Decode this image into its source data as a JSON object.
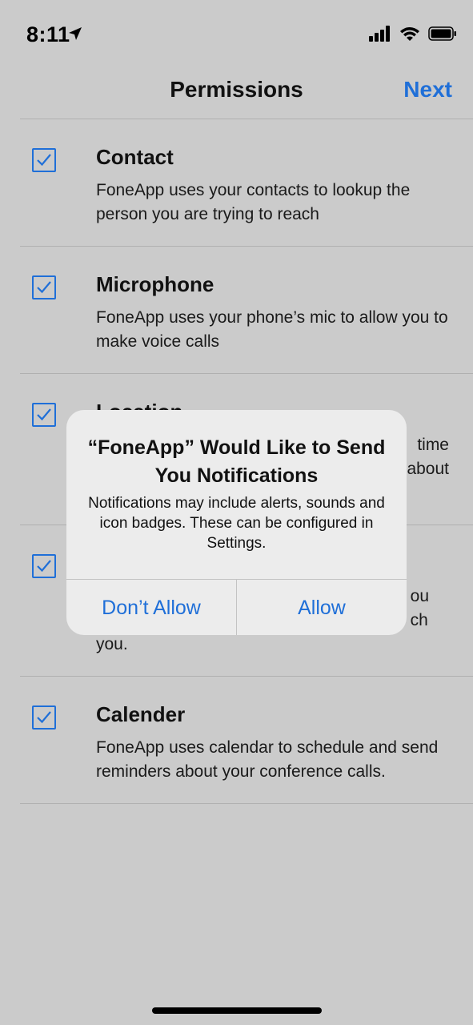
{
  "status_bar": {
    "time": "8:11",
    "icons": [
      "location-arrow-icon",
      "cellular-signal-icon",
      "wifi-icon",
      "battery-icon"
    ]
  },
  "nav": {
    "title": "Permissions",
    "next_label": "Next"
  },
  "permissions": [
    {
      "title": "Contact",
      "description": "FoneApp uses your contacts to lookup the person you are trying to reach",
      "checked": true
    },
    {
      "title": "Microphone",
      "description": "FoneApp uses your phone’s mic to allow you to make voice calls",
      "checked": true
    },
    {
      "title": "Location",
      "description_visible_fragment_1": "time",
      "description_visible_fragment_2": "about",
      "checked": true
    },
    {
      "description_visible_fragment_1": "ou",
      "description_visible_fragment_2": "ch",
      "description_visible_fragment_3": "you.",
      "checked": true
    },
    {
      "title": "Calender",
      "description": "FoneApp uses calendar to schedule and send reminders about your conference calls.",
      "checked": true
    }
  ],
  "alert": {
    "title": "“FoneApp” Would Like to Send You Notifications",
    "message": "Notifications may include alerts, sounds and icon badges. These can be configured in Settings.",
    "deny_label": "Don’t Allow",
    "allow_label": "Allow"
  },
  "colors": {
    "accent": "#1f6fd8",
    "background": "#cbcbcb",
    "alert_background": "#ececec"
  }
}
